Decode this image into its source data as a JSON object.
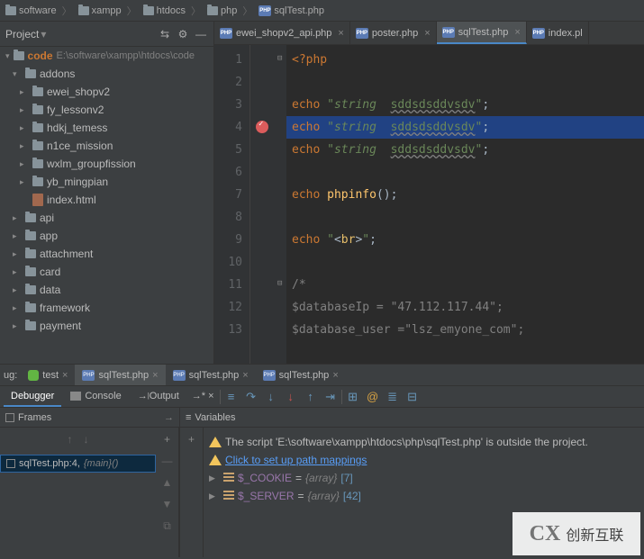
{
  "breadcrumb": [
    "software",
    "xampp",
    "htdocs",
    "php",
    "sqlTest.php"
  ],
  "project_panel": {
    "title": "Project",
    "root_label": "code",
    "root_path": "E:\\software\\xampp\\htdocs\\code"
  },
  "tree": [
    {
      "label": "addons",
      "type": "folder",
      "level": 0,
      "expanded": true
    },
    {
      "label": "ewei_shopv2",
      "type": "folder",
      "level": 1,
      "arrow": true
    },
    {
      "label": "fy_lessonv2",
      "type": "folder",
      "level": 1,
      "arrow": true
    },
    {
      "label": "hdkj_temess",
      "type": "folder",
      "level": 1,
      "arrow": true
    },
    {
      "label": "n1ce_mission",
      "type": "folder",
      "level": 1,
      "arrow": true
    },
    {
      "label": "wxlm_groupfission",
      "type": "folder",
      "level": 1,
      "arrow": true
    },
    {
      "label": "yb_mingpian",
      "type": "folder",
      "level": 1,
      "arrow": true
    },
    {
      "label": "index.html",
      "type": "html",
      "level": 1
    },
    {
      "label": "api",
      "type": "folder",
      "level": 0,
      "arrow": true
    },
    {
      "label": "app",
      "type": "folder",
      "level": 0,
      "arrow": true
    },
    {
      "label": "attachment",
      "type": "folder",
      "level": 0,
      "arrow": true
    },
    {
      "label": "card",
      "type": "folder",
      "level": 0,
      "arrow": true
    },
    {
      "label": "data",
      "type": "folder",
      "level": 0,
      "arrow": true
    },
    {
      "label": "framework",
      "type": "folder",
      "level": 0,
      "arrow": true
    },
    {
      "label": "payment",
      "type": "folder",
      "level": 0,
      "arrow": true
    }
  ],
  "editor_tabs": [
    {
      "label": "ewei_shopv2_api.php",
      "active": false
    },
    {
      "label": "poster.php",
      "active": false
    },
    {
      "label": "sqlTest.php",
      "active": true
    },
    {
      "label": "index.pl",
      "active": false,
      "noclose": true
    }
  ],
  "code": {
    "lines": [
      {
        "n": 1,
        "type": "php_open"
      },
      {
        "n": 2,
        "type": "blank"
      },
      {
        "n": 3,
        "type": "echo_str",
        "kw": "echo",
        "pre": "string  ",
        "err": "sddsdsddvsdv"
      },
      {
        "n": 4,
        "type": "echo_str",
        "kw": "echo",
        "pre": "string  ",
        "err": "sddsdsddvsdv",
        "hl": true,
        "bp": true
      },
      {
        "n": 5,
        "type": "echo_str",
        "kw": "echo",
        "pre": "string  ",
        "err": "sddsdsddvsdv"
      },
      {
        "n": 6,
        "type": "blank"
      },
      {
        "n": 7,
        "type": "echo_func",
        "kw": "echo",
        "fn": "phpinfo"
      },
      {
        "n": 8,
        "type": "blank"
      },
      {
        "n": 9,
        "type": "echo_br",
        "kw": "echo",
        "tag": "br"
      },
      {
        "n": 10,
        "type": "blank"
      },
      {
        "n": 11,
        "type": "cmnt",
        "txt": "/*"
      },
      {
        "n": 12,
        "type": "cmnt",
        "txt": "$databaseIp = \"47.112.117.44\";"
      },
      {
        "n": 13,
        "type": "cmnt",
        "txt": "$database_user =\"lsz_emyone_com\";"
      }
    ]
  },
  "debug": {
    "run_tabs_prefix": "ug:",
    "run_tabs": [
      {
        "label": "test",
        "icon": "bug"
      },
      {
        "label": "sqlTest.php",
        "icon": "php",
        "active": true
      },
      {
        "label": "sqlTest.php",
        "icon": "php-light"
      },
      {
        "label": "sqlTest.php",
        "icon": "php-light"
      }
    ],
    "sub_tabs": {
      "debugger": "Debugger",
      "console": "Console",
      "output": "Output"
    },
    "frames_title": "Frames",
    "vars_title": "Variables",
    "frame_item": {
      "file": "sqlTest.php:4,",
      "fn": "{main}()"
    },
    "warn_msg": "The script 'E:\\software\\xampp\\htdocs\\php\\sqlTest.php' is outside the project.",
    "warn_link": "Click to set up path mappings",
    "vars": [
      {
        "name": "$_COOKIE",
        "len": "[7]"
      },
      {
        "name": "$_SERVER",
        "len": "[42]"
      }
    ],
    "array_label": "{array}"
  },
  "watermark": {
    "logo": "CX",
    "text": "创新互联"
  }
}
